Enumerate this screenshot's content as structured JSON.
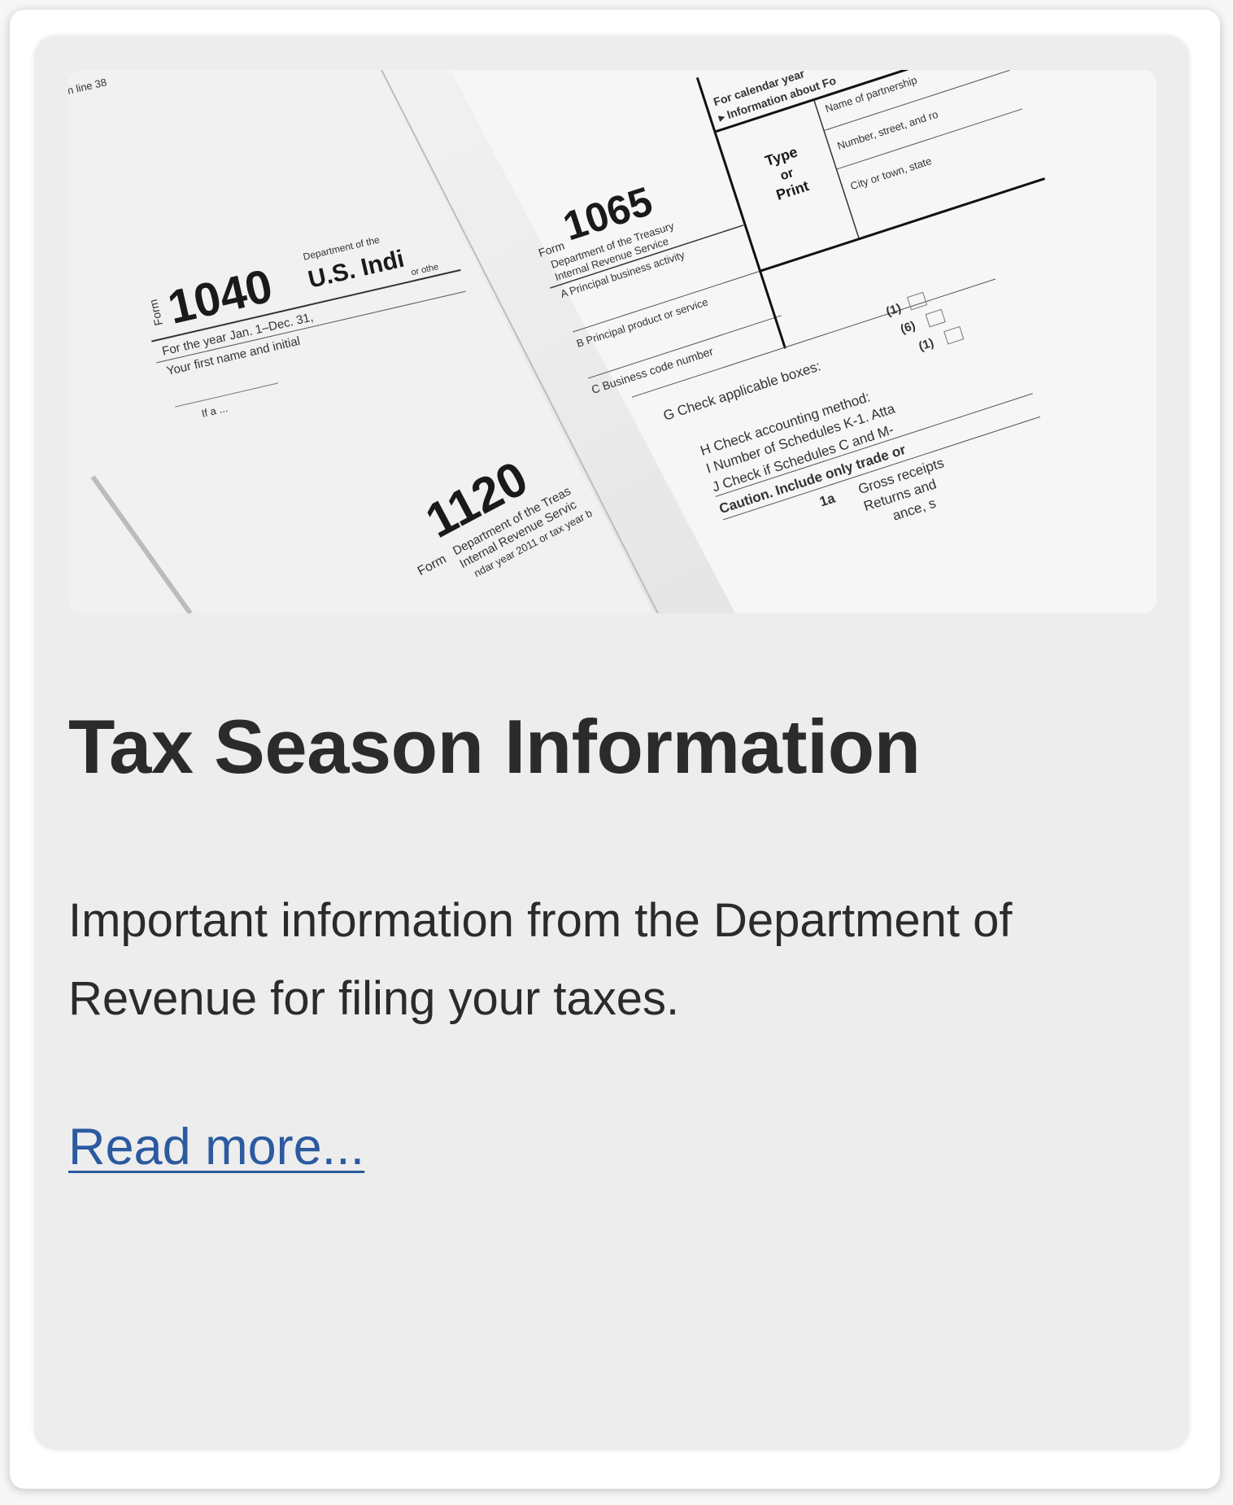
{
  "card": {
    "image_alt": "IRS tax forms 1040, 1065 and 1120",
    "forms": {
      "f1040": {
        "number": "1040",
        "form_label": "Form",
        "agency": "Department of the",
        "title": "U.S. Indi",
        "line1": "For the year Jan. 1–Dec. 31,",
        "line2": "Your first name and initial",
        "line3": "If a ...",
        "corner": "n line 38",
        "other": "or othe"
      },
      "f1065": {
        "number": "1065",
        "form_label": "Form",
        "agency": "Department of the Treasury",
        "agency2": "Internal Revenue Service",
        "header1": "For calendar year",
        "header2": "▸ Information about Fo",
        "box_a": "A  Principal business activity",
        "box_b": "B  Principal product or service",
        "box_c": "C  Business code number",
        "type1": "Type",
        "type2": "or",
        "type3": "Print",
        "name": "Name of partnership",
        "street": "Number, street, and ro",
        "city": "City or town, state",
        "g": "G   Check applicable boxes:",
        "g1": "(1)",
        "g6": "(6)",
        "h": "H   Check accounting method:",
        "h1": "(1)",
        "i": "I    Number of Schedules K-1. Atta",
        "j": "J    Check if Schedules C and M-",
        "caution": "Caution. Include only trade or",
        "l1a": "1a",
        "gross": "Gross receipts",
        "returns": "Returns and",
        "ance": "ance, s"
      },
      "f1120": {
        "number": "1120",
        "form_label": "Form",
        "agency": "Department of the Treas",
        "agency2": "Internal Revenue Servic",
        "line": "ndar year 2011 or tax year b"
      }
    },
    "title": "Tax Season Information",
    "description": "Important information from the Department of Revenue for filing your taxes.",
    "link_label": "Read more..."
  }
}
